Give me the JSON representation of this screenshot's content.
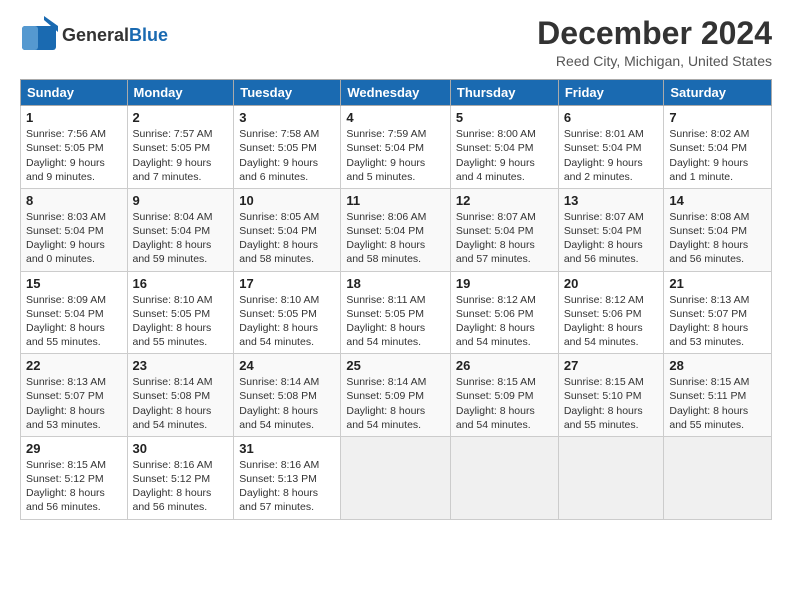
{
  "logo": {
    "general": "General",
    "blue": "Blue"
  },
  "title": "December 2024",
  "location": "Reed City, Michigan, United States",
  "days_header": [
    "Sunday",
    "Monday",
    "Tuesday",
    "Wednesday",
    "Thursday",
    "Friday",
    "Saturday"
  ],
  "weeks": [
    [
      {
        "day": "1",
        "info": "Sunrise: 7:56 AM\nSunset: 5:05 PM\nDaylight: 9 hours and 9 minutes."
      },
      {
        "day": "2",
        "info": "Sunrise: 7:57 AM\nSunset: 5:05 PM\nDaylight: 9 hours and 7 minutes."
      },
      {
        "day": "3",
        "info": "Sunrise: 7:58 AM\nSunset: 5:05 PM\nDaylight: 9 hours and 6 minutes."
      },
      {
        "day": "4",
        "info": "Sunrise: 7:59 AM\nSunset: 5:04 PM\nDaylight: 9 hours and 5 minutes."
      },
      {
        "day": "5",
        "info": "Sunrise: 8:00 AM\nSunset: 5:04 PM\nDaylight: 9 hours and 4 minutes."
      },
      {
        "day": "6",
        "info": "Sunrise: 8:01 AM\nSunset: 5:04 PM\nDaylight: 9 hours and 2 minutes."
      },
      {
        "day": "7",
        "info": "Sunrise: 8:02 AM\nSunset: 5:04 PM\nDaylight: 9 hours and 1 minute."
      }
    ],
    [
      {
        "day": "8",
        "info": "Sunrise: 8:03 AM\nSunset: 5:04 PM\nDaylight: 9 hours and 0 minutes."
      },
      {
        "day": "9",
        "info": "Sunrise: 8:04 AM\nSunset: 5:04 PM\nDaylight: 8 hours and 59 minutes."
      },
      {
        "day": "10",
        "info": "Sunrise: 8:05 AM\nSunset: 5:04 PM\nDaylight: 8 hours and 58 minutes."
      },
      {
        "day": "11",
        "info": "Sunrise: 8:06 AM\nSunset: 5:04 PM\nDaylight: 8 hours and 58 minutes."
      },
      {
        "day": "12",
        "info": "Sunrise: 8:07 AM\nSunset: 5:04 PM\nDaylight: 8 hours and 57 minutes."
      },
      {
        "day": "13",
        "info": "Sunrise: 8:07 AM\nSunset: 5:04 PM\nDaylight: 8 hours and 56 minutes."
      },
      {
        "day": "14",
        "info": "Sunrise: 8:08 AM\nSunset: 5:04 PM\nDaylight: 8 hours and 56 minutes."
      }
    ],
    [
      {
        "day": "15",
        "info": "Sunrise: 8:09 AM\nSunset: 5:04 PM\nDaylight: 8 hours and 55 minutes."
      },
      {
        "day": "16",
        "info": "Sunrise: 8:10 AM\nSunset: 5:05 PM\nDaylight: 8 hours and 55 minutes."
      },
      {
        "day": "17",
        "info": "Sunrise: 8:10 AM\nSunset: 5:05 PM\nDaylight: 8 hours and 54 minutes."
      },
      {
        "day": "18",
        "info": "Sunrise: 8:11 AM\nSunset: 5:05 PM\nDaylight: 8 hours and 54 minutes."
      },
      {
        "day": "19",
        "info": "Sunrise: 8:12 AM\nSunset: 5:06 PM\nDaylight: 8 hours and 54 minutes."
      },
      {
        "day": "20",
        "info": "Sunrise: 8:12 AM\nSunset: 5:06 PM\nDaylight: 8 hours and 54 minutes."
      },
      {
        "day": "21",
        "info": "Sunrise: 8:13 AM\nSunset: 5:07 PM\nDaylight: 8 hours and 53 minutes."
      }
    ],
    [
      {
        "day": "22",
        "info": "Sunrise: 8:13 AM\nSunset: 5:07 PM\nDaylight: 8 hours and 53 minutes."
      },
      {
        "day": "23",
        "info": "Sunrise: 8:14 AM\nSunset: 5:08 PM\nDaylight: 8 hours and 54 minutes."
      },
      {
        "day": "24",
        "info": "Sunrise: 8:14 AM\nSunset: 5:08 PM\nDaylight: 8 hours and 54 minutes."
      },
      {
        "day": "25",
        "info": "Sunrise: 8:14 AM\nSunset: 5:09 PM\nDaylight: 8 hours and 54 minutes."
      },
      {
        "day": "26",
        "info": "Sunrise: 8:15 AM\nSunset: 5:09 PM\nDaylight: 8 hours and 54 minutes."
      },
      {
        "day": "27",
        "info": "Sunrise: 8:15 AM\nSunset: 5:10 PM\nDaylight: 8 hours and 55 minutes."
      },
      {
        "day": "28",
        "info": "Sunrise: 8:15 AM\nSunset: 5:11 PM\nDaylight: 8 hours and 55 minutes."
      }
    ],
    [
      {
        "day": "29",
        "info": "Sunrise: 8:15 AM\nSunset: 5:12 PM\nDaylight: 8 hours and 56 minutes."
      },
      {
        "day": "30",
        "info": "Sunrise: 8:16 AM\nSunset: 5:12 PM\nDaylight: 8 hours and 56 minutes."
      },
      {
        "day": "31",
        "info": "Sunrise: 8:16 AM\nSunset: 5:13 PM\nDaylight: 8 hours and 57 minutes."
      },
      null,
      null,
      null,
      null
    ]
  ]
}
